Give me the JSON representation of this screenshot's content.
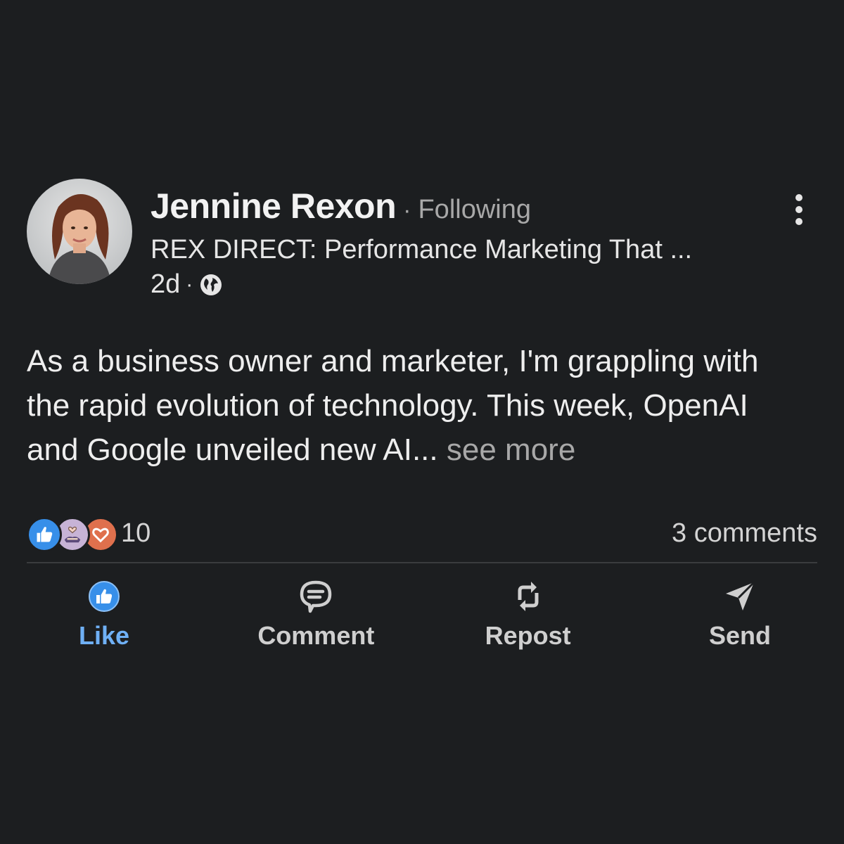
{
  "post": {
    "author": {
      "name": "Jennine Rexon",
      "separator": "·",
      "follow_status": "Following",
      "headline": "REX DIRECT: Performance Marketing That ...",
      "time_ago": "2d",
      "visibility_icon": "globe-icon"
    },
    "body": {
      "text": "As a business owner and marketer, I'm grappling with the rapid evolution of technology. This week, OpenAI and Google unveiled new AI...",
      "see_more_label": "see more"
    },
    "social": {
      "reaction_icons": [
        "like-icon",
        "support-icon",
        "love-icon"
      ],
      "reaction_count": "10",
      "comment_count": "3 comments"
    },
    "actions": [
      {
        "label": "Like",
        "icon": "thumbs-up-icon",
        "active": true
      },
      {
        "label": "Comment",
        "icon": "comment-bubble-icon",
        "active": false
      },
      {
        "label": "Repost",
        "icon": "repost-icon",
        "active": false
      },
      {
        "label": "Send",
        "icon": "send-icon",
        "active": false
      }
    ]
  },
  "colors": {
    "background": "#1c1e20",
    "accent": "#378fe9",
    "active_label": "#6fb0f5",
    "muted_text": "#a8a8a8"
  }
}
